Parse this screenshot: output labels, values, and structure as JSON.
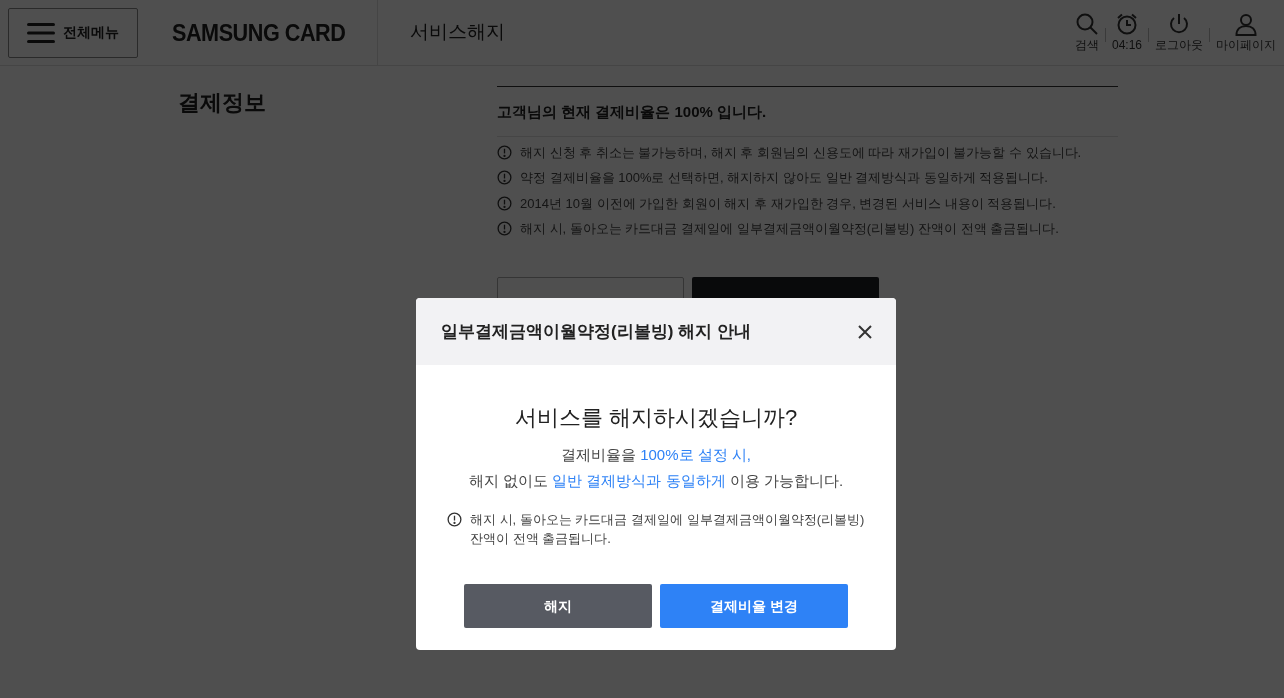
{
  "header": {
    "menu_button": "전체메뉴",
    "logo": "SAMSUNG CARD",
    "page_title": "서비스해지",
    "utilities": [
      {
        "kind": "search",
        "label": "검색"
      },
      {
        "kind": "timer",
        "label": "04:16"
      },
      {
        "kind": "logout",
        "label": "로그아웃"
      },
      {
        "kind": "mypage",
        "label": "마이페이지"
      }
    ]
  },
  "section": {
    "title": "결제정보",
    "summary": "고객님의 현재 결제비율은 100% 입니다.",
    "notices": [
      "해지 신청 후 취소는 불가능하며, 해지 후 회원님의 신용도에 따라 재가입이 불가능할 수 있습니다.",
      "약정 결제비율을 100%로 선택하면, 해지하지 않아도 일반 결제방식과 동일하게 적용됩니다.",
      "2014년 10월 이전에 가입한 회원이 해지 후 재가입한 경우, 변경된 서비스 내용이 적용됩니다.",
      "해지 시, 돌아오는 카드대금 결제일에 일부결제금액이월약정(리볼빙) 잔액이 전액 출금됩니다."
    ],
    "buttons": [
      {
        "kind": "outline"
      },
      {
        "kind": "dark"
      }
    ]
  },
  "modal": {
    "title": "일부결제금액이월약정(리볼빙) 해지 안내",
    "question": "서비스를 해지하시겠습니까?",
    "message_lines": [
      [
        {
          "text": "결제비율을 ",
          "highlight": false
        },
        {
          "text": "100%로 설정 시,",
          "highlight": true
        }
      ],
      [
        {
          "text": "해지 없이도 ",
          "highlight": false
        },
        {
          "text": "일반 결제방식과 동일하게",
          "highlight": true
        },
        {
          "text": " 이용 가능합니다.",
          "highlight": false
        }
      ]
    ],
    "notice": "해지 시, 돌아오는 카드대금 결제일에 일부결제금액이월약정(리볼빙) 잔액이 전액 출금됩니다.",
    "buttons": [
      {
        "label": "해지",
        "kind": "secondary"
      },
      {
        "label": "결제비율 변경",
        "kind": "primary"
      }
    ]
  }
}
